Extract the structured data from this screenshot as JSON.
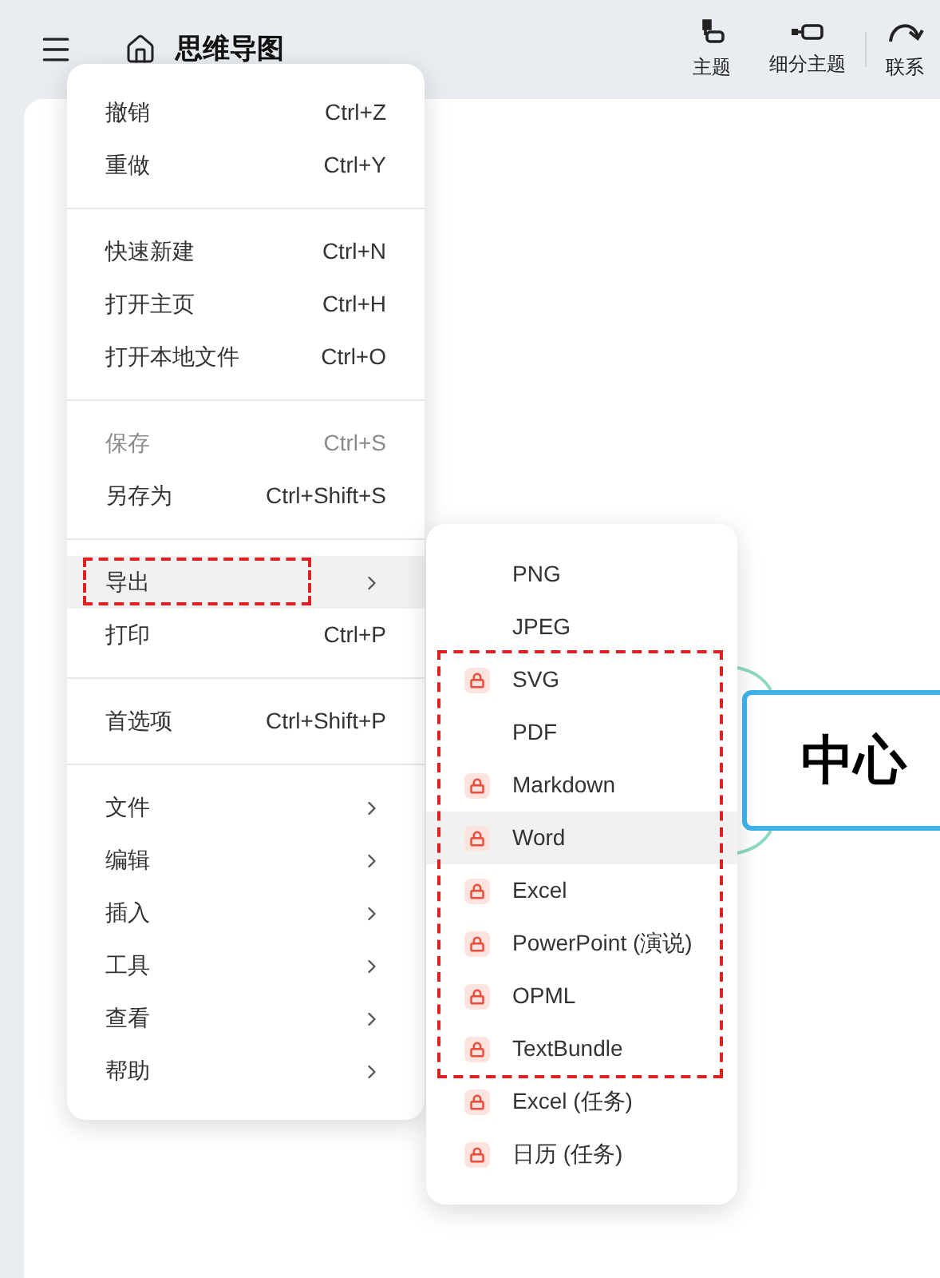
{
  "app_bar": {
    "title": "思维导图",
    "tools": [
      {
        "label": "主题",
        "kind": "topic"
      },
      {
        "label": "细分主题",
        "kind": "subtopic"
      },
      {
        "label": "联系",
        "kind": "relation"
      }
    ]
  },
  "menu": {
    "groups": [
      [
        {
          "label": "撤销",
          "shortcut": "Ctrl+Z",
          "kind": "shortcut",
          "selected": false,
          "disabled": false
        },
        {
          "label": "重做",
          "shortcut": "Ctrl+Y",
          "kind": "shortcut",
          "selected": false,
          "disabled": false
        }
      ],
      [
        {
          "label": "快速新建",
          "shortcut": "Ctrl+N",
          "kind": "shortcut",
          "selected": false,
          "disabled": false
        },
        {
          "label": "打开主页",
          "shortcut": "Ctrl+H",
          "kind": "shortcut",
          "selected": false,
          "disabled": false
        },
        {
          "label": "打开本地文件",
          "shortcut": "Ctrl+O",
          "kind": "shortcut",
          "selected": false,
          "disabled": false
        }
      ],
      [
        {
          "label": "保存",
          "shortcut": "Ctrl+S",
          "kind": "shortcut",
          "selected": false,
          "disabled": true
        },
        {
          "label": "另存为",
          "shortcut": "Ctrl+Shift+S",
          "kind": "shortcut",
          "selected": false,
          "disabled": false
        }
      ],
      [
        {
          "label": "导出",
          "kind": "submenu",
          "selected": true,
          "disabled": false,
          "marked": true
        },
        {
          "label": "打印",
          "shortcut": "Ctrl+P",
          "kind": "shortcut",
          "selected": false,
          "disabled": false
        }
      ],
      [
        {
          "label": "首选项",
          "shortcut": "Ctrl+Shift+P",
          "kind": "shortcut",
          "selected": false,
          "disabled": false
        }
      ],
      [
        {
          "label": "文件",
          "kind": "submenu",
          "selected": false,
          "disabled": false
        },
        {
          "label": "编辑",
          "kind": "submenu",
          "selected": false,
          "disabled": false
        },
        {
          "label": "插入",
          "kind": "submenu",
          "selected": false,
          "disabled": false
        },
        {
          "label": "工具",
          "kind": "submenu",
          "selected": false,
          "disabled": false
        },
        {
          "label": "查看",
          "kind": "submenu",
          "selected": false,
          "disabled": false
        },
        {
          "label": "帮助",
          "kind": "submenu",
          "selected": false,
          "disabled": false
        }
      ]
    ]
  },
  "export_menu": {
    "items": [
      {
        "label": "PNG",
        "locked": false,
        "selected": false,
        "marked": false
      },
      {
        "label": "JPEG",
        "locked": false,
        "selected": false,
        "marked": false
      },
      {
        "label": "SVG",
        "locked": true,
        "selected": false,
        "marked": true
      },
      {
        "label": "PDF",
        "locked": false,
        "selected": false,
        "marked": true
      },
      {
        "label": "Markdown",
        "locked": true,
        "selected": false,
        "marked": true
      },
      {
        "label": "Word",
        "locked": true,
        "selected": true,
        "marked": true
      },
      {
        "label": "Excel",
        "locked": true,
        "selected": false,
        "marked": true
      },
      {
        "label": "PowerPoint (演说)",
        "locked": true,
        "selected": false,
        "marked": true
      },
      {
        "label": "OPML",
        "locked": true,
        "selected": false,
        "marked": true
      },
      {
        "label": "TextBundle",
        "locked": true,
        "selected": false,
        "marked": true
      },
      {
        "label": "Excel (任务)",
        "locked": true,
        "selected": false,
        "marked": false
      },
      {
        "label": "日历 (任务)",
        "locked": true,
        "selected": false,
        "marked": false
      }
    ]
  },
  "canvas": {
    "central_topic": "中心"
  }
}
